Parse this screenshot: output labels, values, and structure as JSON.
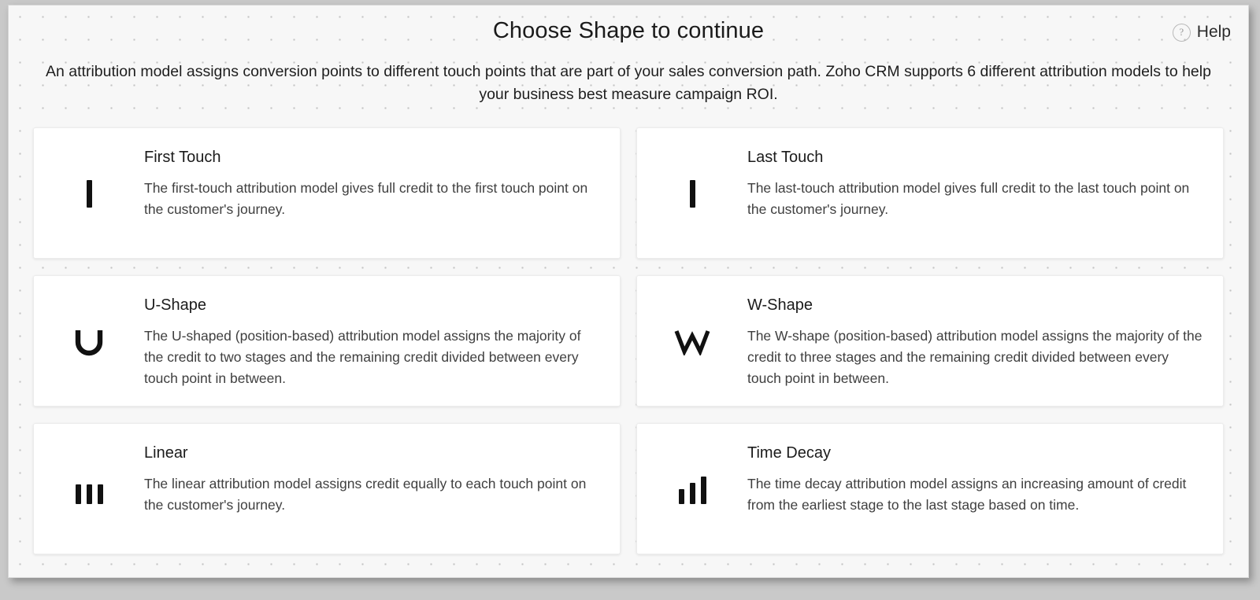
{
  "header": {
    "title": "Choose Shape to continue",
    "help_label": "Help",
    "help_icon_glyph": "?"
  },
  "intro": {
    "text": "An attribution model assigns conversion points to different touch points that are part of your sales conversion path. Zoho CRM supports 6 different attribution models to help your business best measure campaign ROI."
  },
  "cards": [
    {
      "icon": "first-touch-bar-icon",
      "title": "First Touch",
      "description": "The first-touch attribution model gives full credit to the first touch point on the customer's journey."
    },
    {
      "icon": "last-touch-bar-icon",
      "title": "Last Touch",
      "description": "The last-touch attribution model gives full credit to the last touch point on the customer's journey."
    },
    {
      "icon": "u-shape-icon",
      "title": "U-Shape",
      "description": "The U-shaped (position-based) attribution model assigns the majority of the credit to two stages and the remaining credit divided between every touch point in between."
    },
    {
      "icon": "w-shape-icon",
      "title": "W-Shape",
      "description": "The W-shape (position-based) attribution model assigns the majority of the credit to three stages and the remaining credit divided between every touch point in between."
    },
    {
      "icon": "linear-bars-icon",
      "title": "Linear",
      "description": "The linear attribution model assigns credit equally to each touch point on the customer's journey."
    },
    {
      "icon": "time-decay-bars-icon",
      "title": "Time Decay",
      "description": "The time decay attribution model assigns an increasing amount of credit from the earliest stage to the last stage based on time."
    }
  ],
  "colors": {
    "page_background": "#f7f7f7",
    "card_background": "#ffffff",
    "text_primary": "#1b1b1b",
    "text_secondary": "#3f3f3f",
    "glyph": "#111111"
  }
}
